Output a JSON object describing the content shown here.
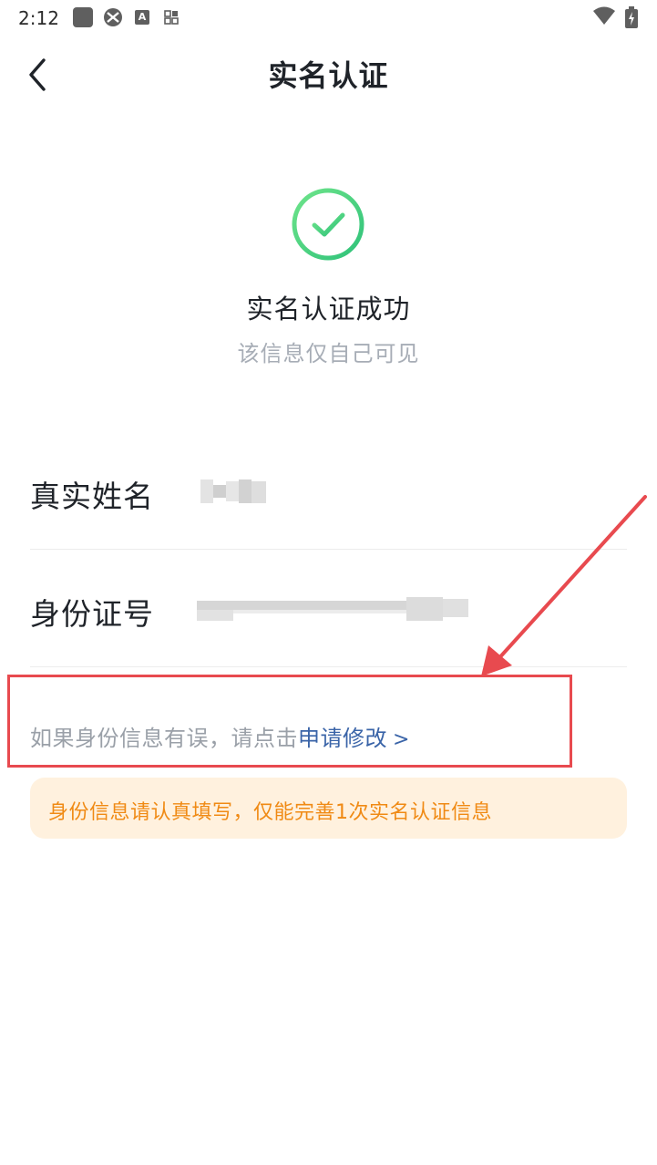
{
  "status_bar": {
    "time": "2:12",
    "icons": [
      "app-square-icon",
      "app-icon",
      "a-badge-icon",
      "qr-grid-icon",
      "wifi-icon",
      "battery-charging-icon"
    ],
    "a_badge": "A"
  },
  "nav": {
    "title": "实名认证",
    "back_icon": "chevron-left-icon"
  },
  "success": {
    "icon": "check-circle-icon",
    "title": "实名认证成功",
    "subtitle": "该信息仅自己可见",
    "accent_color": "#3ecf6e"
  },
  "info": {
    "name_label": "真实姓名",
    "id_label": "身份证号"
  },
  "correction": {
    "prefix": "如果身份信息有误，请点击",
    "link_label": "申请修改",
    "chevron": ">",
    "link_color": "#3a64a8",
    "highlight_color": "#e84a4f"
  },
  "tip": {
    "text": "身份信息请认真填写，仅能完善1次实名认证信息",
    "text_color": "#f08a14",
    "background": "#fff1de"
  }
}
